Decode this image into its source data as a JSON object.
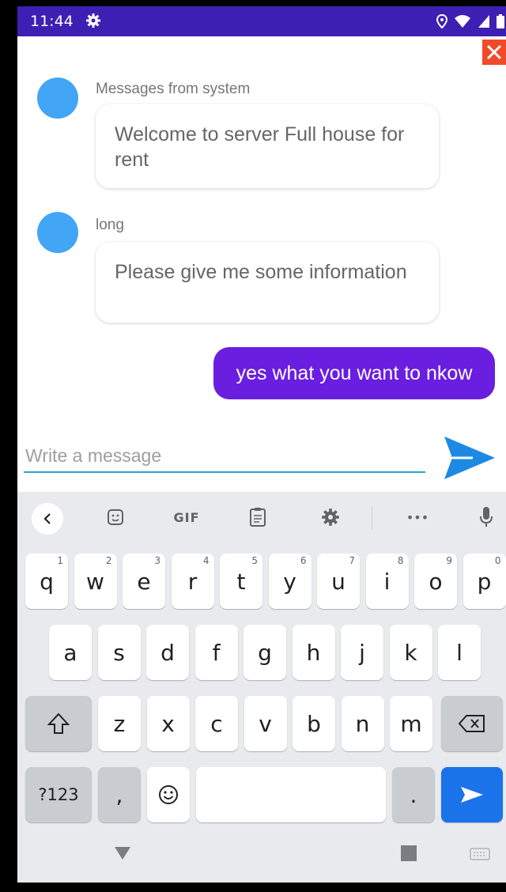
{
  "status_bar": {
    "time": "11:44",
    "icons": [
      "location-icon",
      "wifi-icon",
      "signal-icon",
      "battery-icon"
    ]
  },
  "colors": {
    "status_bar": "#3d1fb4",
    "avatar": "#42a5f5",
    "sent_bubble": "#6a1ee0",
    "send_button": "#1e88e5",
    "close_button": "#f04a2a",
    "input_underline": "#26a6d1",
    "enter_key": "#1a73e8"
  },
  "messages": [
    {
      "sender": "Messages from system",
      "text": "Welcome to server Full house for rent"
    },
    {
      "sender": "long",
      "text": "Please give me some information"
    }
  ],
  "sent_message": {
    "text": "yes what you want to nkow"
  },
  "input": {
    "placeholder": "Write a message",
    "value": ""
  },
  "keyboard": {
    "toolbar": {
      "items": [
        "back-chevron-icon",
        "sticker-icon",
        "GIF",
        "clipboard-icon",
        "gear-icon",
        "more-icon",
        "microphone-icon"
      ],
      "gif_label": "GIF",
      "more_label": "•••"
    },
    "row1": [
      {
        "key": "q",
        "hint": "1"
      },
      {
        "key": "w",
        "hint": "2"
      },
      {
        "key": "e",
        "hint": "3"
      },
      {
        "key": "r",
        "hint": "4"
      },
      {
        "key": "t",
        "hint": "5"
      },
      {
        "key": "y",
        "hint": "6"
      },
      {
        "key": "u",
        "hint": "7"
      },
      {
        "key": "i",
        "hint": "8"
      },
      {
        "key": "o",
        "hint": "9"
      },
      {
        "key": "p",
        "hint": "0"
      }
    ],
    "row2": [
      "a",
      "s",
      "d",
      "f",
      "g",
      "h",
      "j",
      "k",
      "l"
    ],
    "row3": [
      "z",
      "x",
      "c",
      "v",
      "b",
      "n",
      "m"
    ],
    "symbols_label": "?123",
    "comma_label": ",",
    "period_label": "."
  }
}
